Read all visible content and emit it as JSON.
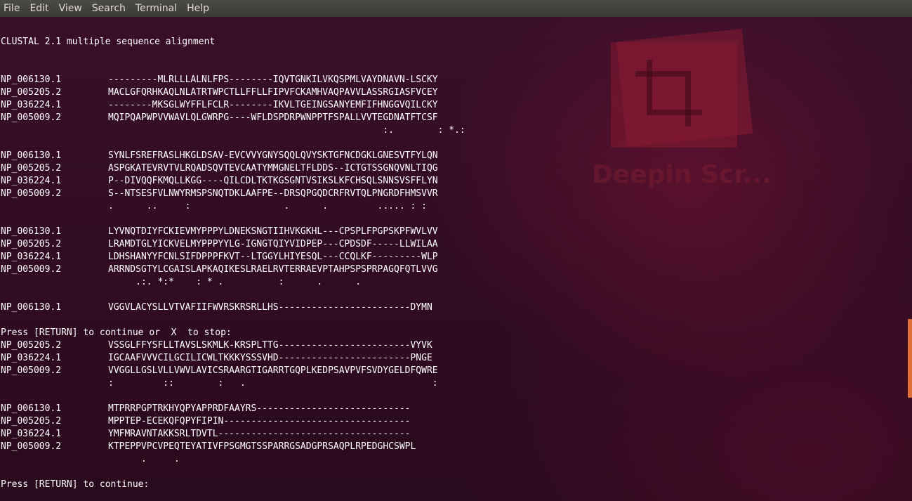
{
  "menu": [
    "File",
    "Edit",
    "View",
    "Search",
    "Terminal",
    "Help"
  ],
  "watermark": "Deepin Scr...",
  "terminal": {
    "top_partial": "",
    "header": "CLUSTAL 2.1 multiple sequence alignment",
    "blocks": [
      {
        "rows": [
          {
            "id": "NP_006130.1",
            "seq": "---------MLRLLLALNLFPS--------IQVTGNKILVKQSPMLVAYDNAVN-LSCKY"
          },
          {
            "id": "NP_005205.2",
            "seq": "MACLGFQRHKAQLNLATRTWPCTLLFFLLFIPVFCKAMHVAQPAVVLASSRGIASFVCEY"
          },
          {
            "id": "NP_036224.1",
            "seq": "--------MKSGLWYFFLFCLR--------IKVLTGEINGSANYEMFIFHNGGVQILCKY"
          },
          {
            "id": "NP_005009.2",
            "seq": "MQIPQAPWPVVWAVLQLGWRPG----WFLDSPDRPWNPPTFSPALLVVTEGDNATFTCSF"
          }
        ],
        "consensus": "                                                  :.        : *.:"
      },
      {
        "rows": [
          {
            "id": "NP_006130.1",
            "seq": "SYNLFSREFRASLHKGLDSAV-EVCVVYGNYSQQLQVYSKTGFNCDGKLGNESVTFYLQN"
          },
          {
            "id": "NP_005205.2",
            "seq": "ASPGKATEVRVTVLRQADSQVTEVCAATYMMGNELTFLDDS--ICTGTSSGNQVNLTIQG"
          },
          {
            "id": "NP_036224.1",
            "seq": "P--DIVQQFKMQLLKGG----QILCDLTKTKGSGNTVSIKSLKFCHSQLSNNSVSFFLYN"
          },
          {
            "id": "NP_005009.2",
            "seq": "S--NTSESFVLNWYRMSPSNQTDKLAAFPE--DRSQPGQDCRFRVTQLPNGRDFHMSVVR"
          }
        ],
        "consensus": ".      ..     :                 .      .         ..... : :"
      },
      {
        "rows": [
          {
            "id": "NP_006130.1",
            "seq": "LYVNQTDIYFCKIEVMYPPPYLDNEKSNGTIIHVKGKHL---CPSPLFPGPSKPFWVLVV"
          },
          {
            "id": "NP_005205.2",
            "seq": "LRAMDTGLYICKVELMYPPPYYLG-IGNGTQIYVIDPEP---CPDSDF-----LLWILAA"
          },
          {
            "id": "NP_036224.1",
            "seq": "LDHSHANYYFCNLSIFDPPPFKVT--LTGGYLHIYESQL---CCQLKF---------WLP"
          },
          {
            "id": "NP_005009.2",
            "seq": "ARRNDSGTYLCGAISLAPKAQIKESLRAELRVTERRAEVPTAHPSPSPRPAGQFQTLVVG"
          }
        ],
        "consensus": "     .:. *:*    : * .          :      .      ."
      },
      {
        "rows": [
          {
            "id": "NP_006130.1",
            "seq": "VGGVLACYSLLVTVAFIIFWVRSKRSRLLHS------------------------DYMN"
          }
        ],
        "consensus": null
      }
    ],
    "prompt_continue_stop": "Press [RETURN] to continue or  X  to stop:",
    "blocks_after": [
      {
        "rows": [
          {
            "id": "NP_005205.2",
            "seq": "VSSGLFFYSFLLTAVSLSKMLK-KRSPLTTG------------------------VYVK"
          },
          {
            "id": "NP_036224.1",
            "seq": "IGCAAFVVVCILGCILICWLTKKKYSSSVHD------------------------PNGE"
          },
          {
            "id": "NP_005009.2",
            "seq": "VVGGLLGSLVLLVWVLAVICSRAARGTIGARRTGQPLKEDPSAVPVFSVDYGELDFQWRE"
          }
        ],
        "consensus": ":         ::        :   .                                  :"
      },
      {
        "rows": [
          {
            "id": "NP_006130.1",
            "seq": "MTPRRPGPTRKHYQPYAPPRDFAAYRS----------------------------"
          },
          {
            "id": "NP_005205.2",
            "seq": "MPPTEP-ECEKQFQPYFIPIN----------------------------------"
          },
          {
            "id": "NP_036224.1",
            "seq": "YMFMRAVNTAKKSRLTDVTL-----------------------------------"
          },
          {
            "id": "NP_005009.2",
            "seq": "KTPEPPVPCVPEQTEYATIVFPSGMGTSSPARRGSADGPRSAQPLRPEDGHCSWPL"
          }
        ],
        "consensus": "      .     ."
      }
    ],
    "prompt_continue": "Press [RETURN] to continue:"
  }
}
